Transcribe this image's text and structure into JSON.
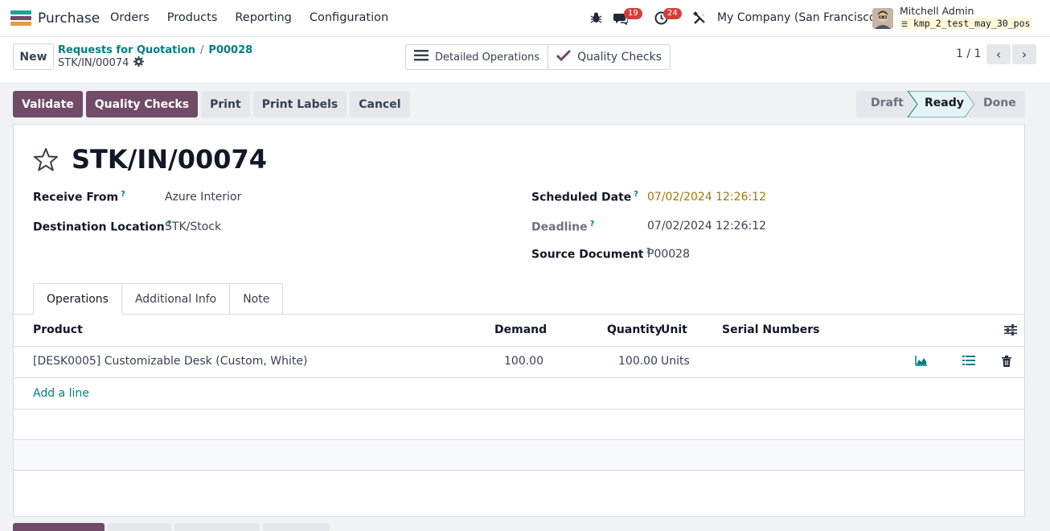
{
  "navbar": {
    "app_name": "Purchase",
    "menu": [
      "Orders",
      "Products",
      "Reporting",
      "Configuration"
    ],
    "bug_icon": "bug-icon",
    "messages_badge": "19",
    "activities_badge": "24",
    "company": "My Company (San Francisco)",
    "user_name": "Mitchell Admin",
    "database": "kmp_2_test_may_30_pos"
  },
  "control_panel": {
    "new_label": "New",
    "breadcrumb": [
      "Requests for Quotation",
      "P00028"
    ],
    "record_name": "STK/IN/00074",
    "detailed_operations_label": "Detailed Operations",
    "quality_checks_label": "Quality Checks",
    "pager": "1 / 1"
  },
  "actions": {
    "validate": "Validate",
    "quality_checks": "Quality Checks",
    "print": "Print",
    "print_labels": "Print Labels",
    "cancel": "Cancel"
  },
  "statusbar": {
    "stages": [
      "Draft",
      "Ready",
      "Done"
    ],
    "current": "Ready"
  },
  "form": {
    "title": "STK/IN/00074",
    "receive_from_label": "Receive From",
    "receive_from": "Azure Interior",
    "destination_label": "Destination Location",
    "destination": "STK/Stock",
    "scheduled_date_label": "Scheduled Date",
    "scheduled_date": "07/02/2024 12:26:12",
    "deadline_label": "Deadline",
    "deadline": "07/02/2024 12:26:12",
    "source_document_label": "Source Document",
    "source_document": "P00028",
    "help_mark": "?"
  },
  "tabs": [
    "Operations",
    "Additional Info",
    "Note"
  ],
  "operations": {
    "columns": {
      "product": "Product",
      "demand": "Demand",
      "quantity": "Quantity",
      "unit": "Unit",
      "serial_numbers": "Serial Numbers"
    },
    "rows": [
      {
        "product": "[DESK0005] Customizable Desk (Custom, White)",
        "demand": "100.00",
        "quantity": "100.00",
        "unit": "Units"
      }
    ],
    "add_line": "Add a line"
  },
  "colors": {
    "primary": "#714b67",
    "link": "#017e84",
    "warning_date": "#a1750e",
    "badge": "#d23f3a"
  }
}
